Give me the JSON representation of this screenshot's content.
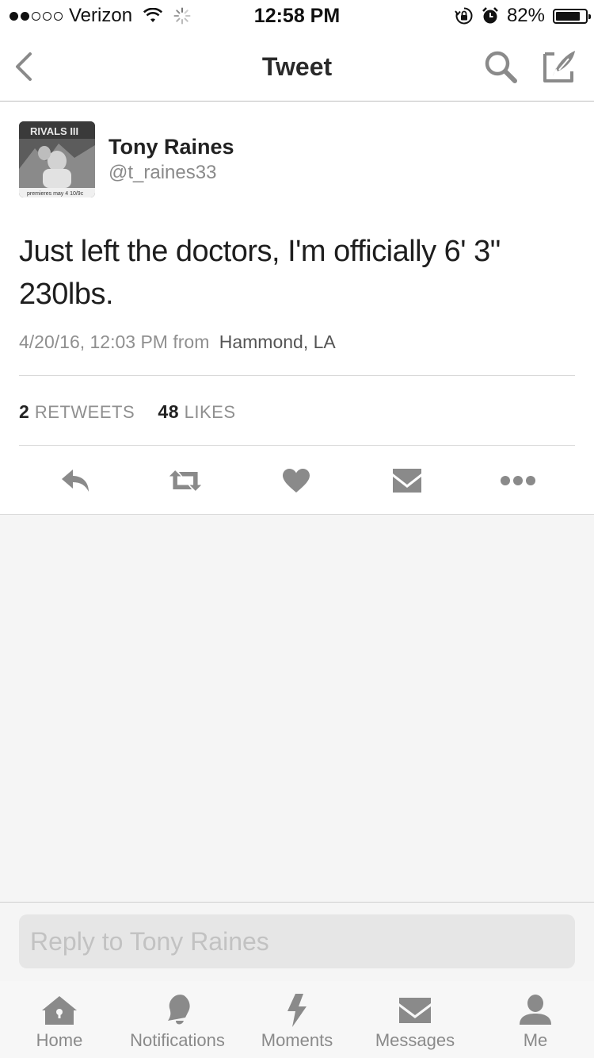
{
  "status_bar": {
    "carrier": "Verizon",
    "time": "12:58 PM",
    "battery": "82%",
    "battery_level": 0.82,
    "signal_bars_filled": 2,
    "signal_bars_total": 5,
    "icons": [
      "wifi-icon",
      "activity-spinner-icon",
      "rotation-lock-icon",
      "alarm-icon",
      "battery-icon"
    ]
  },
  "nav": {
    "title": "Tweet",
    "back_icon": "chevron-left-icon",
    "search_icon": "search-icon",
    "compose_icon": "compose-tweet-icon"
  },
  "tweet": {
    "author_name": "Tony Raines",
    "author_handle": "@t_raines33",
    "avatar_text_top": "RIVALS III",
    "avatar_text_bottom": "premieres may 4 10/9c",
    "text": "Just left the doctors, I'm officially 6' 3\" 230lbs.",
    "timestamp": "4/20/16, 12:03 PM",
    "from_label": "from",
    "location": "Hammond, LA",
    "retweets_count": "2",
    "retweets_label": "RETWEETS",
    "likes_count": "48",
    "likes_label": "LIKES"
  },
  "actions": [
    "reply-icon",
    "retweet-icon",
    "like-icon",
    "direct-message-icon",
    "more-icon"
  ],
  "reply": {
    "placeholder": "Reply to Tony Raines"
  },
  "tabs": [
    {
      "label": "Home",
      "icon": "home-icon"
    },
    {
      "label": "Notifications",
      "icon": "notifications-icon"
    },
    {
      "label": "Moments",
      "icon": "moments-icon"
    },
    {
      "label": "Messages",
      "icon": "messages-icon"
    },
    {
      "label": "Me",
      "icon": "profile-icon"
    }
  ],
  "colors": {
    "icon_grey": "#8a8a8a",
    "text_dark": "#1e1e1e",
    "background_grey": "#f5f5f5"
  }
}
